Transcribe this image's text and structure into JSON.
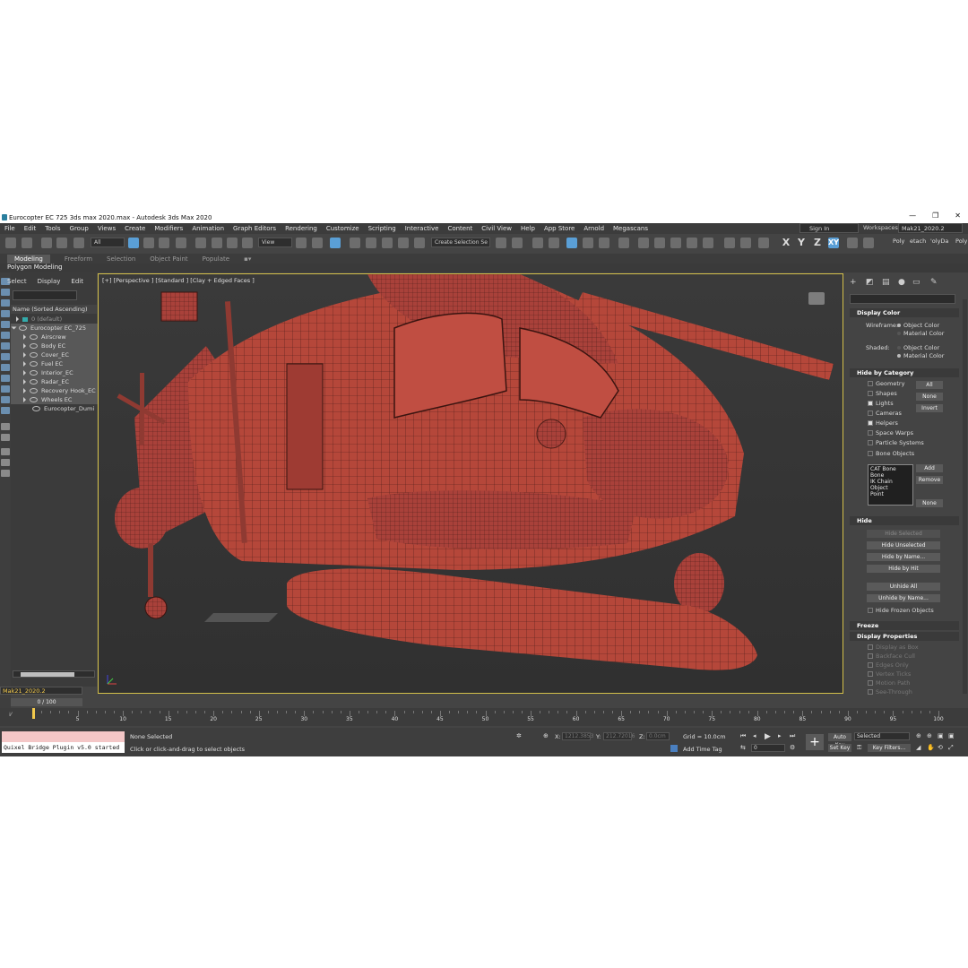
{
  "window": {
    "title": "Eurocopter EC 725 3ds max 2020.max - Autodesk 3ds Max 2020",
    "controls": [
      "—",
      "❐",
      "✕"
    ]
  },
  "menu": [
    "File",
    "Edit",
    "Tools",
    "Group",
    "Views",
    "Create",
    "Modifiers",
    "Animation",
    "Graph Editors",
    "Rendering",
    "Customize",
    "Scripting",
    "Interactive",
    "Content",
    "Civil View",
    "Help",
    "App Store",
    "Arnold",
    "Megascans"
  ],
  "account": {
    "sign_in": "Sign In",
    "workspaces_label": "Workspaces:",
    "workspace": "Mak21_2020.2"
  },
  "toolbar": {
    "filter_dropdown": "All",
    "refcoord_dropdown": "View",
    "selection_set": "Create Selection Se",
    "axis_x": "X",
    "axis_y": "Y",
    "axis_z": "Z",
    "axis_xy": "XY",
    "right_items": [
      "Poly",
      "etach",
      "'olyDa",
      "Poly"
    ]
  },
  "ribbon": {
    "tabs": [
      "Modeling",
      "Freeform",
      "Selection",
      "Object Paint",
      "Populate"
    ],
    "active": "Modeling",
    "sub": "Polygon Modeling"
  },
  "scene_explorer": {
    "tabs": [
      "Select",
      "Display",
      "Edit"
    ],
    "header": "Name (Sorted Ascending)",
    "rows": [
      {
        "name": "0 (default)",
        "level": 1,
        "dim": true
      },
      {
        "name": "Eurocopter EC_725",
        "level": 0
      },
      {
        "name": "Airscrew",
        "level": 2
      },
      {
        "name": "Body EC",
        "level": 2
      },
      {
        "name": "Cover_EC",
        "level": 2
      },
      {
        "name": "Fuel EC",
        "level": 2
      },
      {
        "name": "Interior_EC",
        "level": 2
      },
      {
        "name": "Radar_EC",
        "level": 2
      },
      {
        "name": "Recovery Hook_EC",
        "level": 2
      },
      {
        "name": "Wheels EC",
        "level": 2
      },
      {
        "name": "Eurocopter_Dumi",
        "level": 2
      }
    ],
    "layer": "Mak21_2020.2"
  },
  "viewport": {
    "label": "[+] [Perspective ] [Standard ] [Clay + Edged Faces ]",
    "model_color": "#b5473a"
  },
  "command_panel": {
    "display_color": {
      "title": "Display Color",
      "wireframe_label": "Wireframe:",
      "shaded_label": "Shaded:",
      "object_color": "Object Color",
      "material_color": "Material Color"
    },
    "hide_by_category": {
      "title": "Hide by Category",
      "items": [
        {
          "label": "Geometry",
          "checked": false
        },
        {
          "label": "Shapes",
          "checked": false
        },
        {
          "label": "Lights",
          "checked": true
        },
        {
          "label": "Cameras",
          "checked": false
        },
        {
          "label": "Helpers",
          "checked": true
        },
        {
          "label": "Space Warps",
          "checked": false
        },
        {
          "label": "Particle Systems",
          "checked": false
        },
        {
          "label": "Bone Objects",
          "checked": false
        }
      ],
      "buttons": [
        "All",
        "None",
        "Invert"
      ],
      "list": [
        "CAT Bone",
        "Bone",
        "IK Chain Object",
        "Point"
      ],
      "list_buttons": [
        "Add",
        "Remove",
        "None"
      ]
    },
    "hide": {
      "title": "Hide",
      "buttons": [
        "Hide Selected",
        "Hide Unselected",
        "Hide by Name...",
        "Hide by Hit",
        "Unhide All",
        "Unhide by Name..."
      ],
      "frozen": "Hide Frozen Objects"
    },
    "freeze": {
      "title": "Freeze"
    },
    "display_properties": {
      "title": "Display Properties",
      "items": [
        "Display as Box",
        "Backface Cull",
        "Edges Only",
        "Vertex Ticks",
        "Motion Path",
        "See-Through"
      ]
    }
  },
  "timeline": {
    "slider": "0 / 100",
    "ticks": [
      "5",
      "10",
      "15",
      "20",
      "25",
      "30",
      "35",
      "40",
      "45",
      "50",
      "55",
      "60",
      "65",
      "70",
      "75",
      "80",
      "85",
      "90",
      "95",
      "100"
    ]
  },
  "status": {
    "maxscript_output": "Quixel Bridge Plugin v5.0 started",
    "selection": "None Selected",
    "prompt": "Click or click-and-drag to select objects",
    "x_label": "X:",
    "x_value": "1212.3853",
    "y_label": "Y:",
    "y_value": "212.72016",
    "z_label": "Z:",
    "z_value": "0.0cm",
    "grid": "Grid = 10.0cm",
    "add_time_tag": "Add Time Tag",
    "auto_key": "Auto Key",
    "set_key": "Set Key",
    "selected_dropdown": "Selected",
    "key_filters": "Key Filters...",
    "frame": "0"
  }
}
